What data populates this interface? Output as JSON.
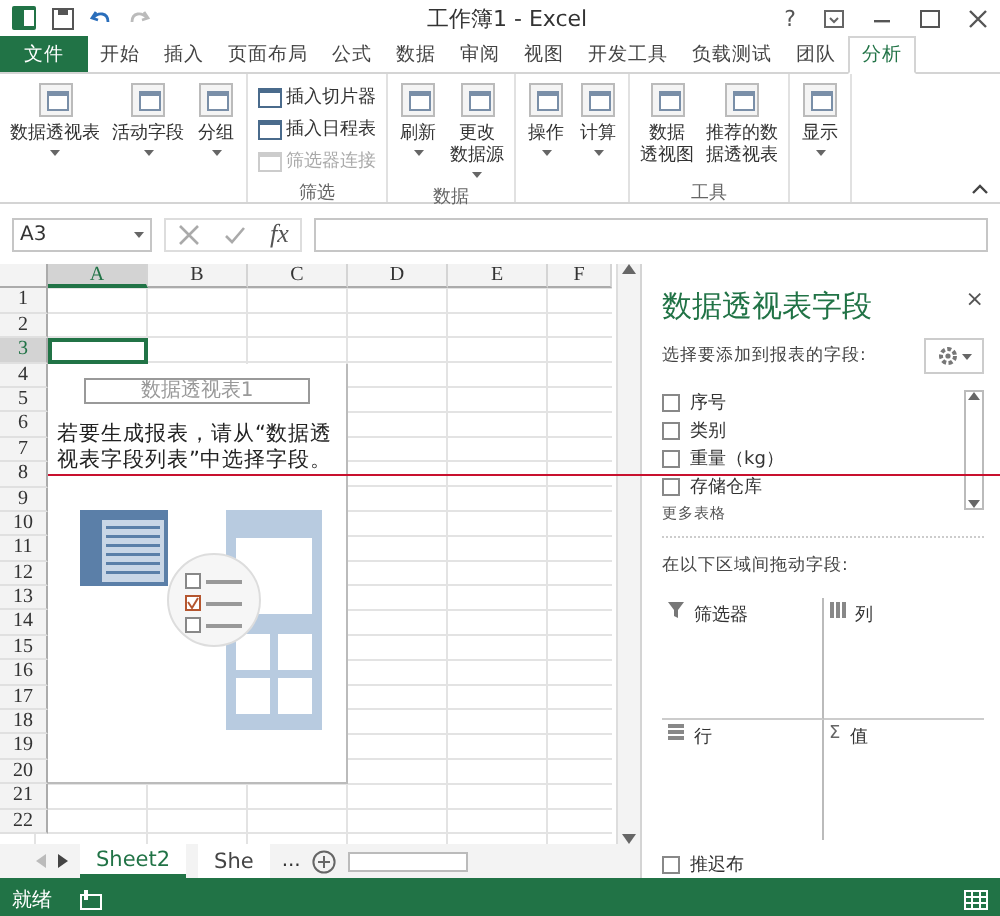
{
  "title_bar": {
    "title": "工作簿1 - Excel",
    "help": "?"
  },
  "ribbon_tabs": [
    {
      "label": "文件",
      "kind": "file",
      "selected": false
    },
    {
      "label": "开始",
      "selected": false
    },
    {
      "label": "插入",
      "selected": false
    },
    {
      "label": "页面布局",
      "selected": false
    },
    {
      "label": "公式",
      "selected": false
    },
    {
      "label": "数据",
      "selected": false
    },
    {
      "label": "审阅",
      "selected": false
    },
    {
      "label": "视图",
      "selected": false
    },
    {
      "label": "开发工具",
      "selected": false
    },
    {
      "label": "负载测试",
      "selected": false
    },
    {
      "label": "团队",
      "selected": false
    },
    {
      "label": "分析",
      "selected": true
    }
  ],
  "ribbon_groups": [
    {
      "buttons": [
        {
          "kind": "large",
          "lines": [
            "数据透视表"
          ],
          "dropdown": true
        },
        {
          "kind": "large",
          "lines": [
            "活动字段"
          ],
          "dropdown": true
        },
        {
          "kind": "large",
          "lines": [
            "分组"
          ],
          "dropdown": true
        }
      ]
    },
    {
      "label": "筛选",
      "buttons": [
        {
          "kind": "small",
          "lines": [
            "插入切片器"
          ],
          "disabled": false
        },
        {
          "kind": "small",
          "lines": [
            "插入日程表"
          ],
          "disabled": false
        },
        {
          "kind": "small",
          "lines": [
            "筛选器连接"
          ],
          "disabled": true
        }
      ]
    },
    {
      "label": "数据",
      "buttons": [
        {
          "kind": "large",
          "lines": [
            "刷新"
          ],
          "dropdown": true
        },
        {
          "kind": "large",
          "lines": [
            "更改",
            "数据源"
          ],
          "dropdown": true
        }
      ]
    },
    {
      "buttons": [
        {
          "kind": "large",
          "lines": [
            "操作"
          ],
          "dropdown": true
        },
        {
          "kind": "large",
          "lines": [
            "计算"
          ],
          "dropdown": true
        }
      ]
    },
    {
      "label": "工具",
      "buttons": [
        {
          "kind": "large",
          "lines": [
            "数据",
            "透视图"
          ],
          "dropdown": false
        },
        {
          "kind": "large",
          "lines": [
            "推荐的数",
            "据透视表"
          ],
          "dropdown": false
        }
      ]
    },
    {
      "buttons": [
        {
          "kind": "large",
          "lines": [
            "显示"
          ],
          "dropdown": true
        }
      ]
    }
  ],
  "formula_bar": {
    "name_box": "A3",
    "fx": "fx"
  },
  "columns": [
    {
      "label": "A",
      "selected": true
    },
    {
      "label": "B",
      "selected": false
    },
    {
      "label": "C",
      "selected": false
    },
    {
      "label": "D",
      "selected": false
    },
    {
      "label": "E",
      "selected": false
    },
    {
      "label": "F",
      "selected": false
    }
  ],
  "rows": [
    {
      "label": "1",
      "selected": false
    },
    {
      "label": "2",
      "selected": false
    },
    {
      "label": "3",
      "selected": true
    },
    {
      "label": "4",
      "selected": false
    },
    {
      "label": "5",
      "selected": false
    },
    {
      "label": "6",
      "selected": false
    },
    {
      "label": "7",
      "selected": false
    },
    {
      "label": "8",
      "selected": false
    },
    {
      "label": "9",
      "selected": false
    },
    {
      "label": "10",
      "selected": false
    },
    {
      "label": "11",
      "selected": false
    },
    {
      "label": "12",
      "selected": false
    },
    {
      "label": "13",
      "selected": false
    },
    {
      "label": "14",
      "selected": false
    },
    {
      "label": "15",
      "selected": false
    },
    {
      "label": "16",
      "selected": false
    },
    {
      "label": "17",
      "selected": false
    },
    {
      "label": "18",
      "selected": false
    },
    {
      "label": "19",
      "selected": false
    },
    {
      "label": "20",
      "selected": false
    },
    {
      "label": "21",
      "selected": false
    },
    {
      "label": "22",
      "selected": false
    }
  ],
  "pivot_placeholder": {
    "title": "数据透视表1",
    "hint": "若要生成报表，请从“数据透视表字段列表”中选择字段。"
  },
  "sheet_tabs": [
    {
      "label": "Sheet2",
      "selected": true
    },
    {
      "label": "She",
      "selected": false
    }
  ],
  "sheet_tabs_more": "...",
  "status_bar": {
    "text": "就绪"
  },
  "field_pane": {
    "title": "数据透视表字段",
    "close": "×",
    "prompt": "选择要添加到报表的字段:",
    "fields": [
      {
        "label": "序号",
        "checked": false
      },
      {
        "label": "类别",
        "checked": false
      },
      {
        "label": "重量（kg）",
        "checked": false
      },
      {
        "label": "存储仓库",
        "checked": false
      }
    ],
    "more_tables": "更多表格",
    "areas_prompt": "在以下区域间拖动字段:",
    "areas": [
      {
        "kind": "filter",
        "label": "筛选器"
      },
      {
        "kind": "columns",
        "label": "列"
      },
      {
        "kind": "rows",
        "label": "行"
      },
      {
        "kind": "values",
        "label": "值",
        "symbol": "Σ"
      }
    ],
    "defer": {
      "label": "推迟布",
      "checked": false
    }
  }
}
